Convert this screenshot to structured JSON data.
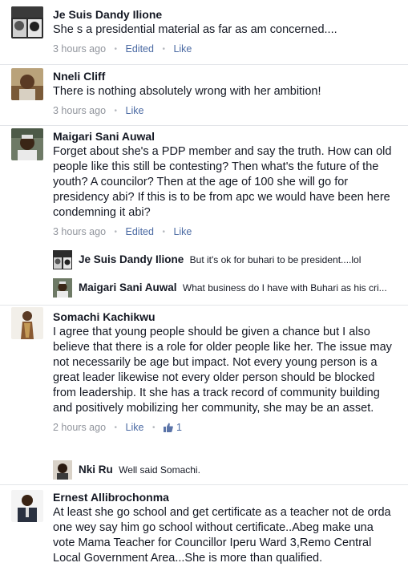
{
  "comments": [
    {
      "author": "Je Suis Dandy Ilione",
      "text": "She s a presidential material as far as am concerned....",
      "time": "3 hours ago",
      "edited": "Edited",
      "like": "Like"
    },
    {
      "author": "Nneli Cliff",
      "text": "There is nothing absolutely wrong with her ambition!",
      "time": "3 hours ago",
      "like": "Like"
    },
    {
      "author": "Maigari Sani Auwal",
      "text": "Forget about she's a PDP member and say the truth. How can old people like this still be contesting? Then what's the future of the youth? A councilor? Then at the age of 100 she will go for presidency abi? If this is to be from apc we would have been here condemning it abi?",
      "time": "3 hours ago",
      "edited": "Edited",
      "like": "Like",
      "replies": [
        {
          "author": "Je Suis Dandy Ilione",
          "text": "But it's ok for buhari to be president....lol"
        },
        {
          "author": "Maigari Sani Auwal",
          "text": "What business do I have with Buhari as his cri..."
        }
      ]
    },
    {
      "author": "Somachi Kachikwu",
      "text": "I agree that young people should be given a chance but I also believe that there is a role for older people like her. The issue may not necessarily be age but impact. Not every young person is a great leader likewise not every older person should be blocked from leadership. It she has a track record of community building and positively mobilizing her community, she may be an asset.",
      "time": "2 hours ago",
      "like": "Like",
      "like_count": "1",
      "replies": [
        {
          "author": "Nki Ru",
          "text": "Well said Somachi."
        }
      ]
    },
    {
      "author": "Ernest Allibrochonma",
      "text": "At least she go school and get certificate as a teacher not de orda one wey say him go school without certificate..Abeg make una vote Mama Teacher for Councillor Iperu Ward 3,Remo Central Local Government Area...She is more than qualified.",
      "time": ""
    }
  ],
  "icons": {
    "like_count_icon": "thumbs-up-icon",
    "separator": "•"
  },
  "colors": {
    "author": "#141823",
    "meta": "#90949c",
    "action": "#4b6aa3",
    "divider": "#e3e5e9"
  }
}
